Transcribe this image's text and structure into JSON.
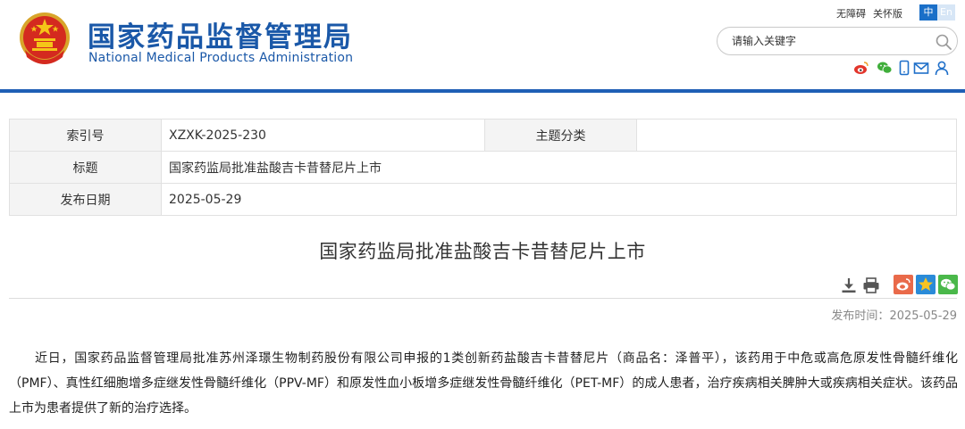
{
  "header": {
    "title_cn": "国家药品监督管理局",
    "title_en": "National Medical Products Administration",
    "links": {
      "accessibility": "无障碍",
      "elder": "关怀版"
    },
    "lang": {
      "zh": "中",
      "en": "En"
    },
    "search": {
      "placeholder": "请输入关键字"
    },
    "social_icons": [
      "weibo-icon",
      "wechat-icon",
      "mobile-icon",
      "mail-icon",
      "user-icon"
    ]
  },
  "info": {
    "index_label": "索引号",
    "index_value": "XZXK-2025-230",
    "category_label": "主题分类",
    "category_value": "",
    "title_label": "标题",
    "title_value": "国家药监局批准盐酸吉卡昔替尼片上市",
    "date_label": "发布日期",
    "date_value": "2025-05-29"
  },
  "article": {
    "title": "国家药监局批准盐酸吉卡昔替尼片上市",
    "pubdate_label": "发布时间：",
    "pubdate_value": "2025-05-29",
    "body": "近日，国家药品监督管理局批准苏州泽璟生物制药股份有限公司申报的1类创新药盐酸吉卡昔替尼片（商品名：泽普平），该药用于中危或高危原发性骨髓纤维化（PMF）、真性红细胞增多症继发性骨髓纤维化（PPV-MF）和原发性血小板增多症继发性骨髓纤维化（PET-MF）的成人患者，治疗疾病相关脾肿大或疾病相关症状。该药品上市为患者提供了新的治疗选择。"
  },
  "colors": {
    "brand_blue": "#1a58a8",
    "header_line": "#1f5fb5",
    "table_label_bg": "#f4f4f4"
  }
}
